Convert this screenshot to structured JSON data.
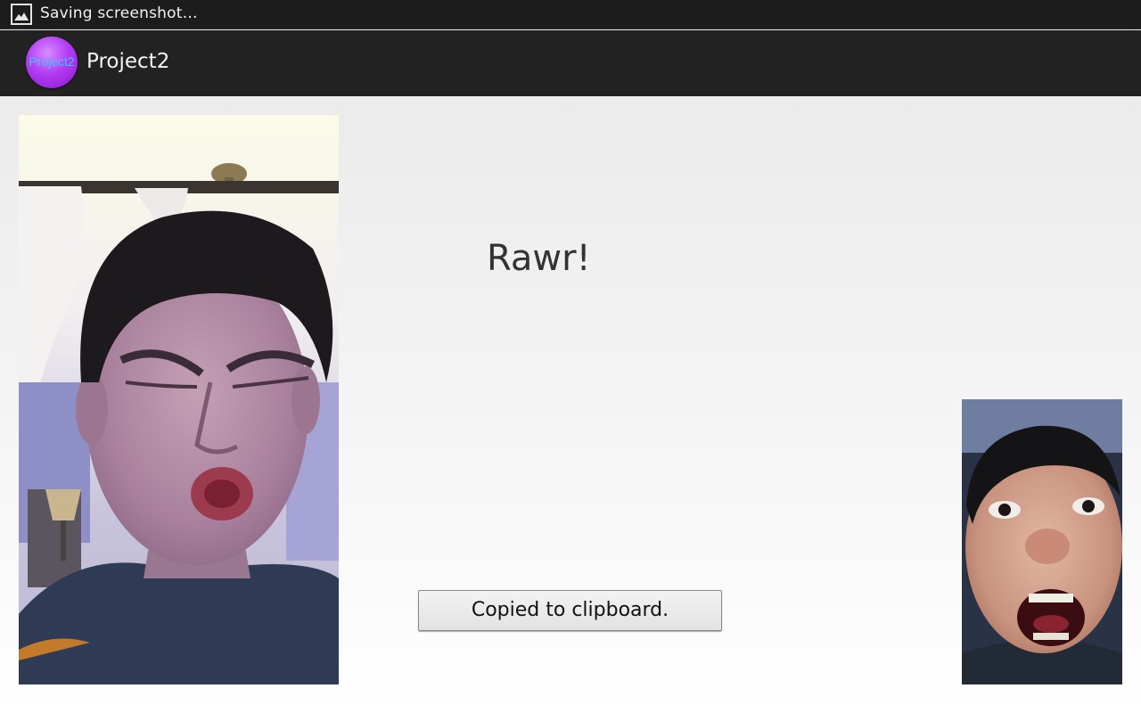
{
  "statusbar": {
    "icon": "image-icon",
    "text": "Saving screenshot…"
  },
  "actionbar": {
    "app_icon_label": "Project2",
    "title": "Project2"
  },
  "main": {
    "left_photo": {
      "icon": "face-photo"
    },
    "right_photo": {
      "icon": "face-photo"
    },
    "message": "Rawr!",
    "clipboard_button_label": "Copied to clipboard."
  }
}
